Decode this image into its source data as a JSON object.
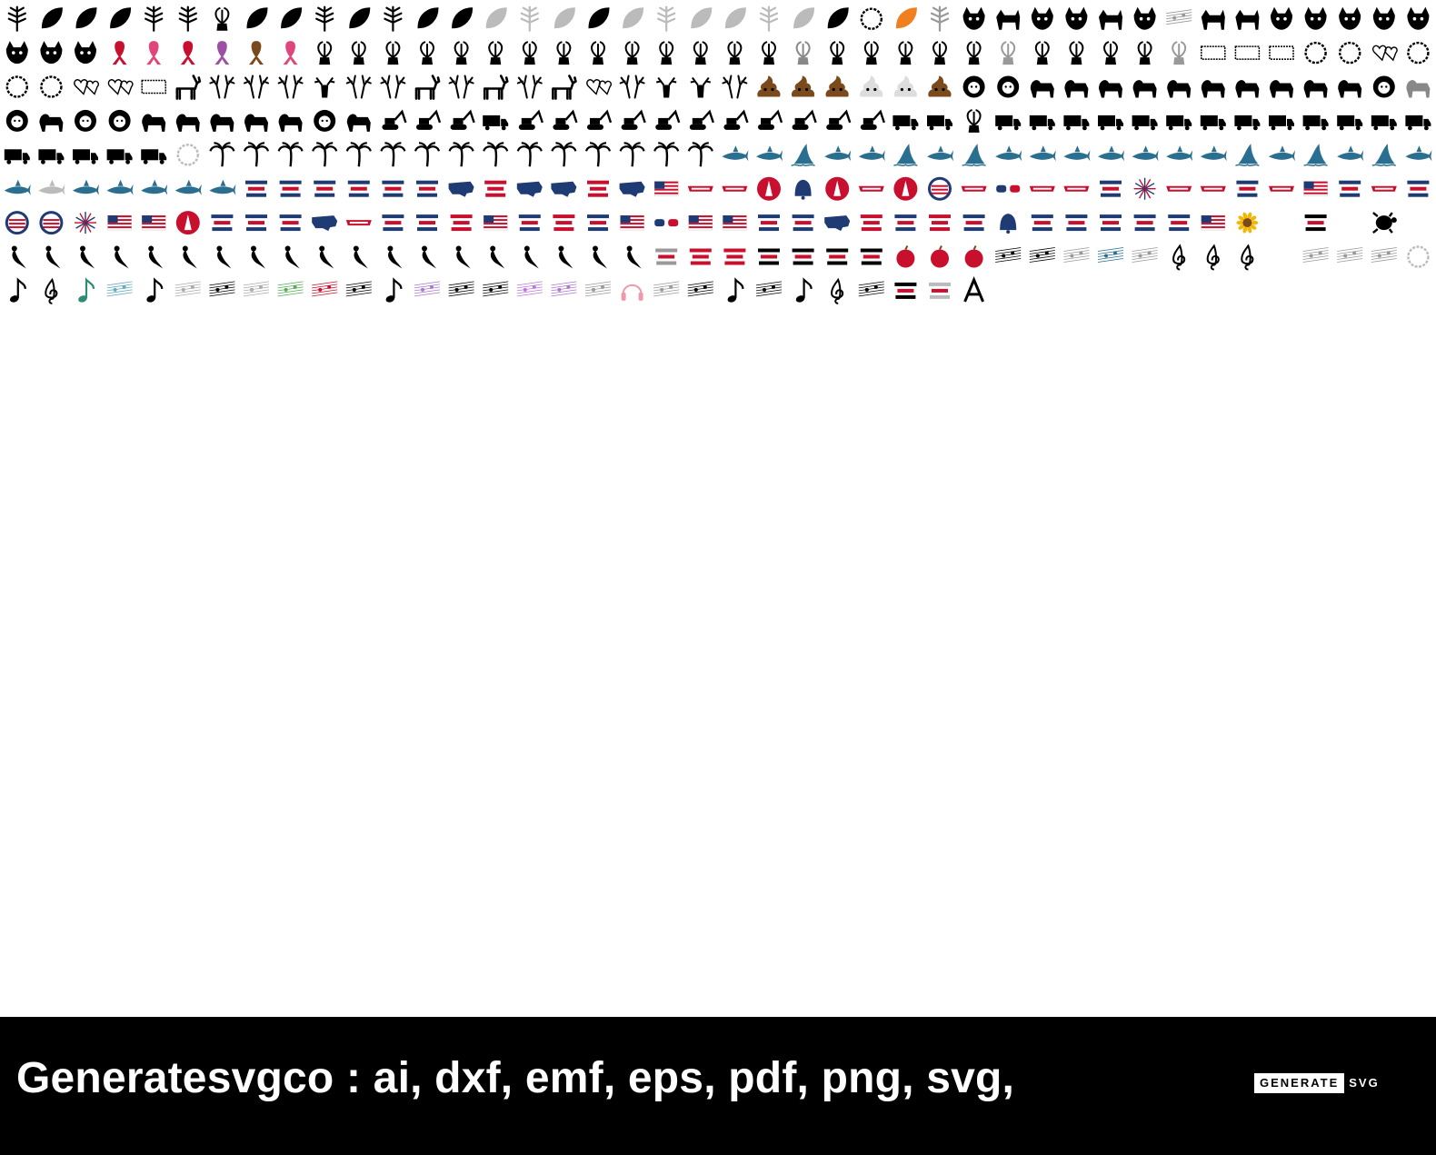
{
  "sheet": {
    "rows": [
      {
        "theme": "leaves-plants-and-dogs",
        "count": 42
      },
      {
        "theme": "dogs-cow-and-awareness-ribbons",
        "count": 42
      },
      {
        "theme": "frames-deer-antlers-and-emoji",
        "count": 42
      },
      {
        "theme": "lions-and-construction-vehicles",
        "count": 42
      },
      {
        "theme": "trucks-and-palm-trees-and-sharks",
        "count": 42
      },
      {
        "theme": "sharks-and-usa-patriotic",
        "count": 42
      },
      {
        "theme": "usa-patriotic-designs",
        "count": 42
      },
      {
        "theme": "mermaids-teacher-and-music",
        "count": 42
      },
      {
        "theme": "music-notes-and-misc",
        "count": 31
      }
    ],
    "palette": {
      "black": "#000000",
      "red": "#c8102e",
      "navy": "#1f3b73",
      "shark_blue": "#2a6f8f",
      "pink": "#e0457b",
      "purple": "#9c4fa3",
      "brown": "#7a4a1c",
      "orange": "#f07f1f",
      "sunflower": "#f2b705"
    }
  },
  "footer": {
    "text": "Generatesvgco : ai, dxf, emf, eps, pdf, png, svg,",
    "logo_box": "GENERATE",
    "logo_tail": "SVG"
  }
}
